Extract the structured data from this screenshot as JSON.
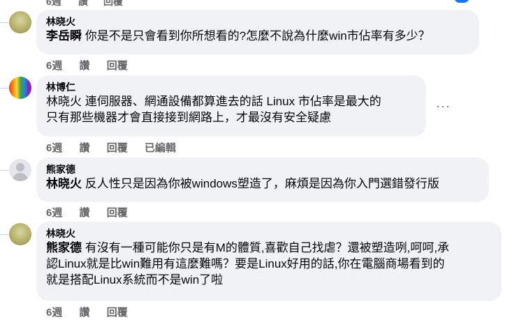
{
  "top": {
    "time": "6週",
    "like": "讚",
    "reply": "回覆"
  },
  "comments": [
    {
      "author": "林晓火",
      "mention": "李岳瞬",
      "text": " 你是不是只會看到你所想看的?怎麼不說為什麼win市佔率有多少？",
      "time": "6週",
      "like": "讚",
      "reply": "回覆"
    },
    {
      "author": "林博仁",
      "line1": "林晓火 連伺服器、網通設備都算進去的話 Linux 市佔率是最大的",
      "line2": "只有那些機器才會直接接到網路上，才最沒有安全疑慮",
      "more": "···",
      "time": "6週",
      "like": "讚",
      "reply": "回覆",
      "edited": "已編輯"
    },
    {
      "author": "熊家德",
      "mention": "林晓火",
      "text": " 反人性只是因為你被windows塑造了，麻煩是因為你入門選錯發行版",
      "time": "6週",
      "like": "讚",
      "reply": "回覆"
    },
    {
      "author": "林晓火",
      "mention": "熊家德",
      "line1": " 有沒有一種可能你只是有M的體質,喜歡自己找虐？還被塑造咧,呵呵,承",
      "line2": "認Linux就是比win難用有這麼難嗎？要是Linux好用的話,你在電腦商場看到的",
      "line3": "就是搭配Linux系統而不是win了啦",
      "time": "6週",
      "like": "讚",
      "reply": "回覆"
    }
  ]
}
